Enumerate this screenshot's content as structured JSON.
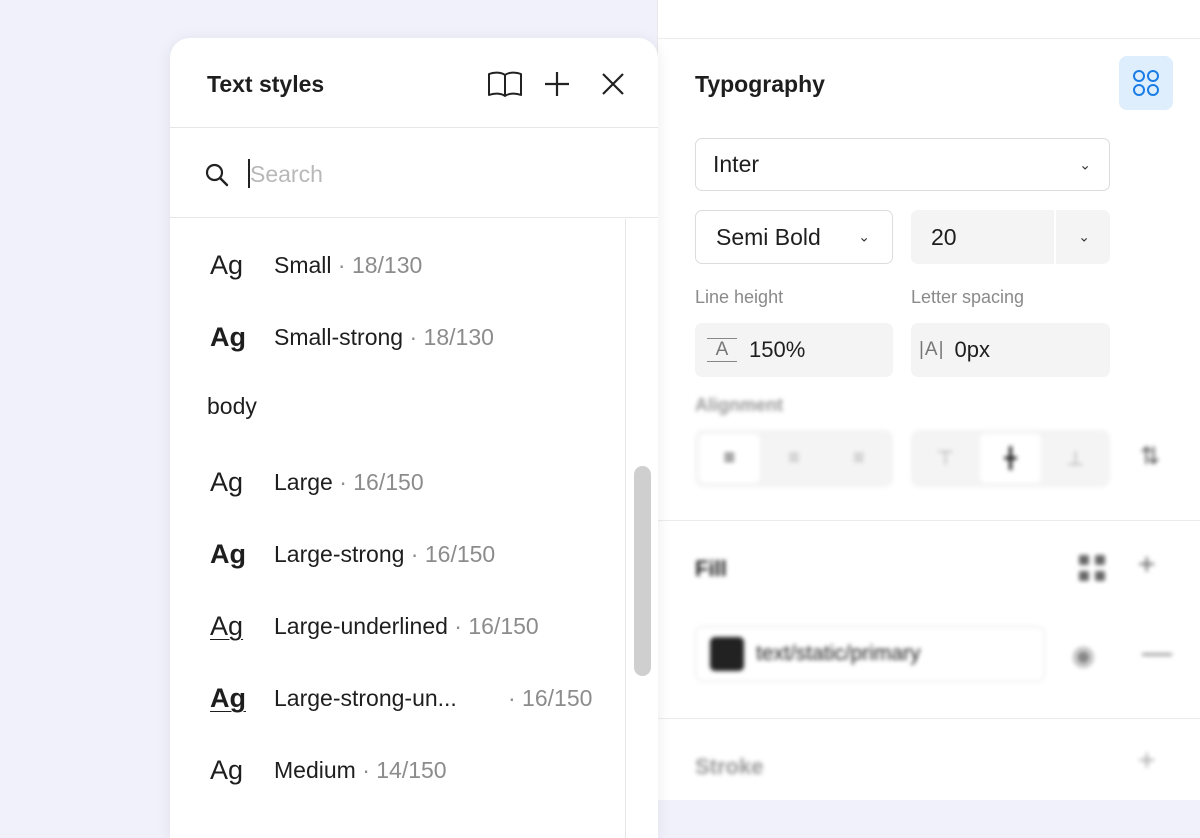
{
  "popup": {
    "title": "Text styles",
    "icons": {
      "library": "book-icon",
      "add": "plus-icon",
      "close": "close-icon"
    },
    "search": {
      "placeholder": "Search",
      "value": ""
    },
    "items": [
      {
        "type": "style",
        "ag": "Ag",
        "weight": "regular",
        "underline": false,
        "name": "Small",
        "meta": " · 18/130"
      },
      {
        "type": "style",
        "ag": "Ag",
        "weight": "bold",
        "underline": false,
        "name": "Small-strong",
        "meta": " · 18/130"
      },
      {
        "type": "group",
        "label": "body"
      },
      {
        "type": "style",
        "ag": "Ag",
        "weight": "regular",
        "underline": false,
        "name": "Large",
        "meta": " · 16/150"
      },
      {
        "type": "style",
        "ag": "Ag",
        "weight": "bold",
        "underline": false,
        "name": "Large-strong",
        "meta": " · 16/150"
      },
      {
        "type": "style",
        "ag": "Ag",
        "weight": "regular",
        "underline": true,
        "name": "Large-underlined",
        "meta": " · 16/150"
      },
      {
        "type": "style",
        "ag": "Ag",
        "weight": "bold",
        "underline": true,
        "name": "Large-strong-un...",
        "meta_right": "· 16/150"
      },
      {
        "type": "style",
        "ag": "Ag",
        "weight": "regular",
        "underline": false,
        "name": "Medium",
        "meta": " · 14/150"
      }
    ]
  },
  "typography": {
    "title": "Typography",
    "styles_icon": "style-grid-icon",
    "font_family": "Inter",
    "font_weight": "Semi Bold",
    "font_size": "20",
    "line_height_label": "Line height",
    "line_height_icon_text": "A",
    "line_height_value": "150%",
    "letter_spacing_label": "Letter spacing",
    "letter_spacing_icon_text": "|A|",
    "letter_spacing_value": "0px",
    "alignment_label": "Alignment",
    "horizontal_align": [
      "align-left-icon",
      "align-center-icon",
      "align-right-icon"
    ],
    "vertical_align": [
      "align-top-icon",
      "align-middle-icon",
      "align-bottom-icon"
    ],
    "vertical_active": "align-middle-icon"
  },
  "fill": {
    "label": "Fill",
    "swatch_color": "#222222",
    "style_name": "text/static/primary"
  },
  "stroke": {
    "label": "Stroke"
  },
  "colors": {
    "accent_bg": "#deeefd",
    "accent": "#1a7de6"
  }
}
